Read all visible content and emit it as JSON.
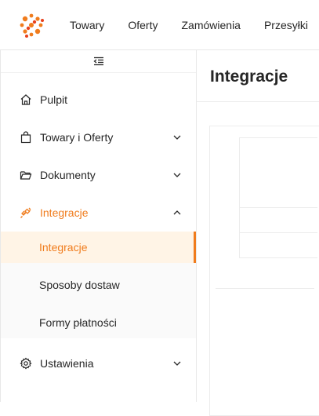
{
  "brand": {
    "accent": "#f07c1d",
    "accent_bg": "#fff4e6"
  },
  "topnav": {
    "items": [
      {
        "label": "Towary"
      },
      {
        "label": "Oferty"
      },
      {
        "label": "Zamówienia"
      },
      {
        "label": "Przesyłki"
      }
    ]
  },
  "sidebar": {
    "collapse_icon": "menu-fold-icon",
    "items": [
      {
        "label": "Pulpit",
        "icon": "home-icon"
      },
      {
        "label": "Towary i Oferty",
        "icon": "shopping-bag-icon",
        "expandable": true
      },
      {
        "label": "Dokumenty",
        "icon": "folder-open-icon",
        "expandable": true
      },
      {
        "label": "Integracje",
        "icon": "plug-icon",
        "expanded": true,
        "active": true
      },
      {
        "label": "Ustawienia",
        "icon": "gear-icon",
        "expandable": true
      }
    ],
    "submenu": [
      {
        "label": "Integracje",
        "selected": true
      },
      {
        "label": "Sposoby dostaw"
      },
      {
        "label": "Formy płatności"
      }
    ]
  },
  "main": {
    "title": "Integracje"
  }
}
